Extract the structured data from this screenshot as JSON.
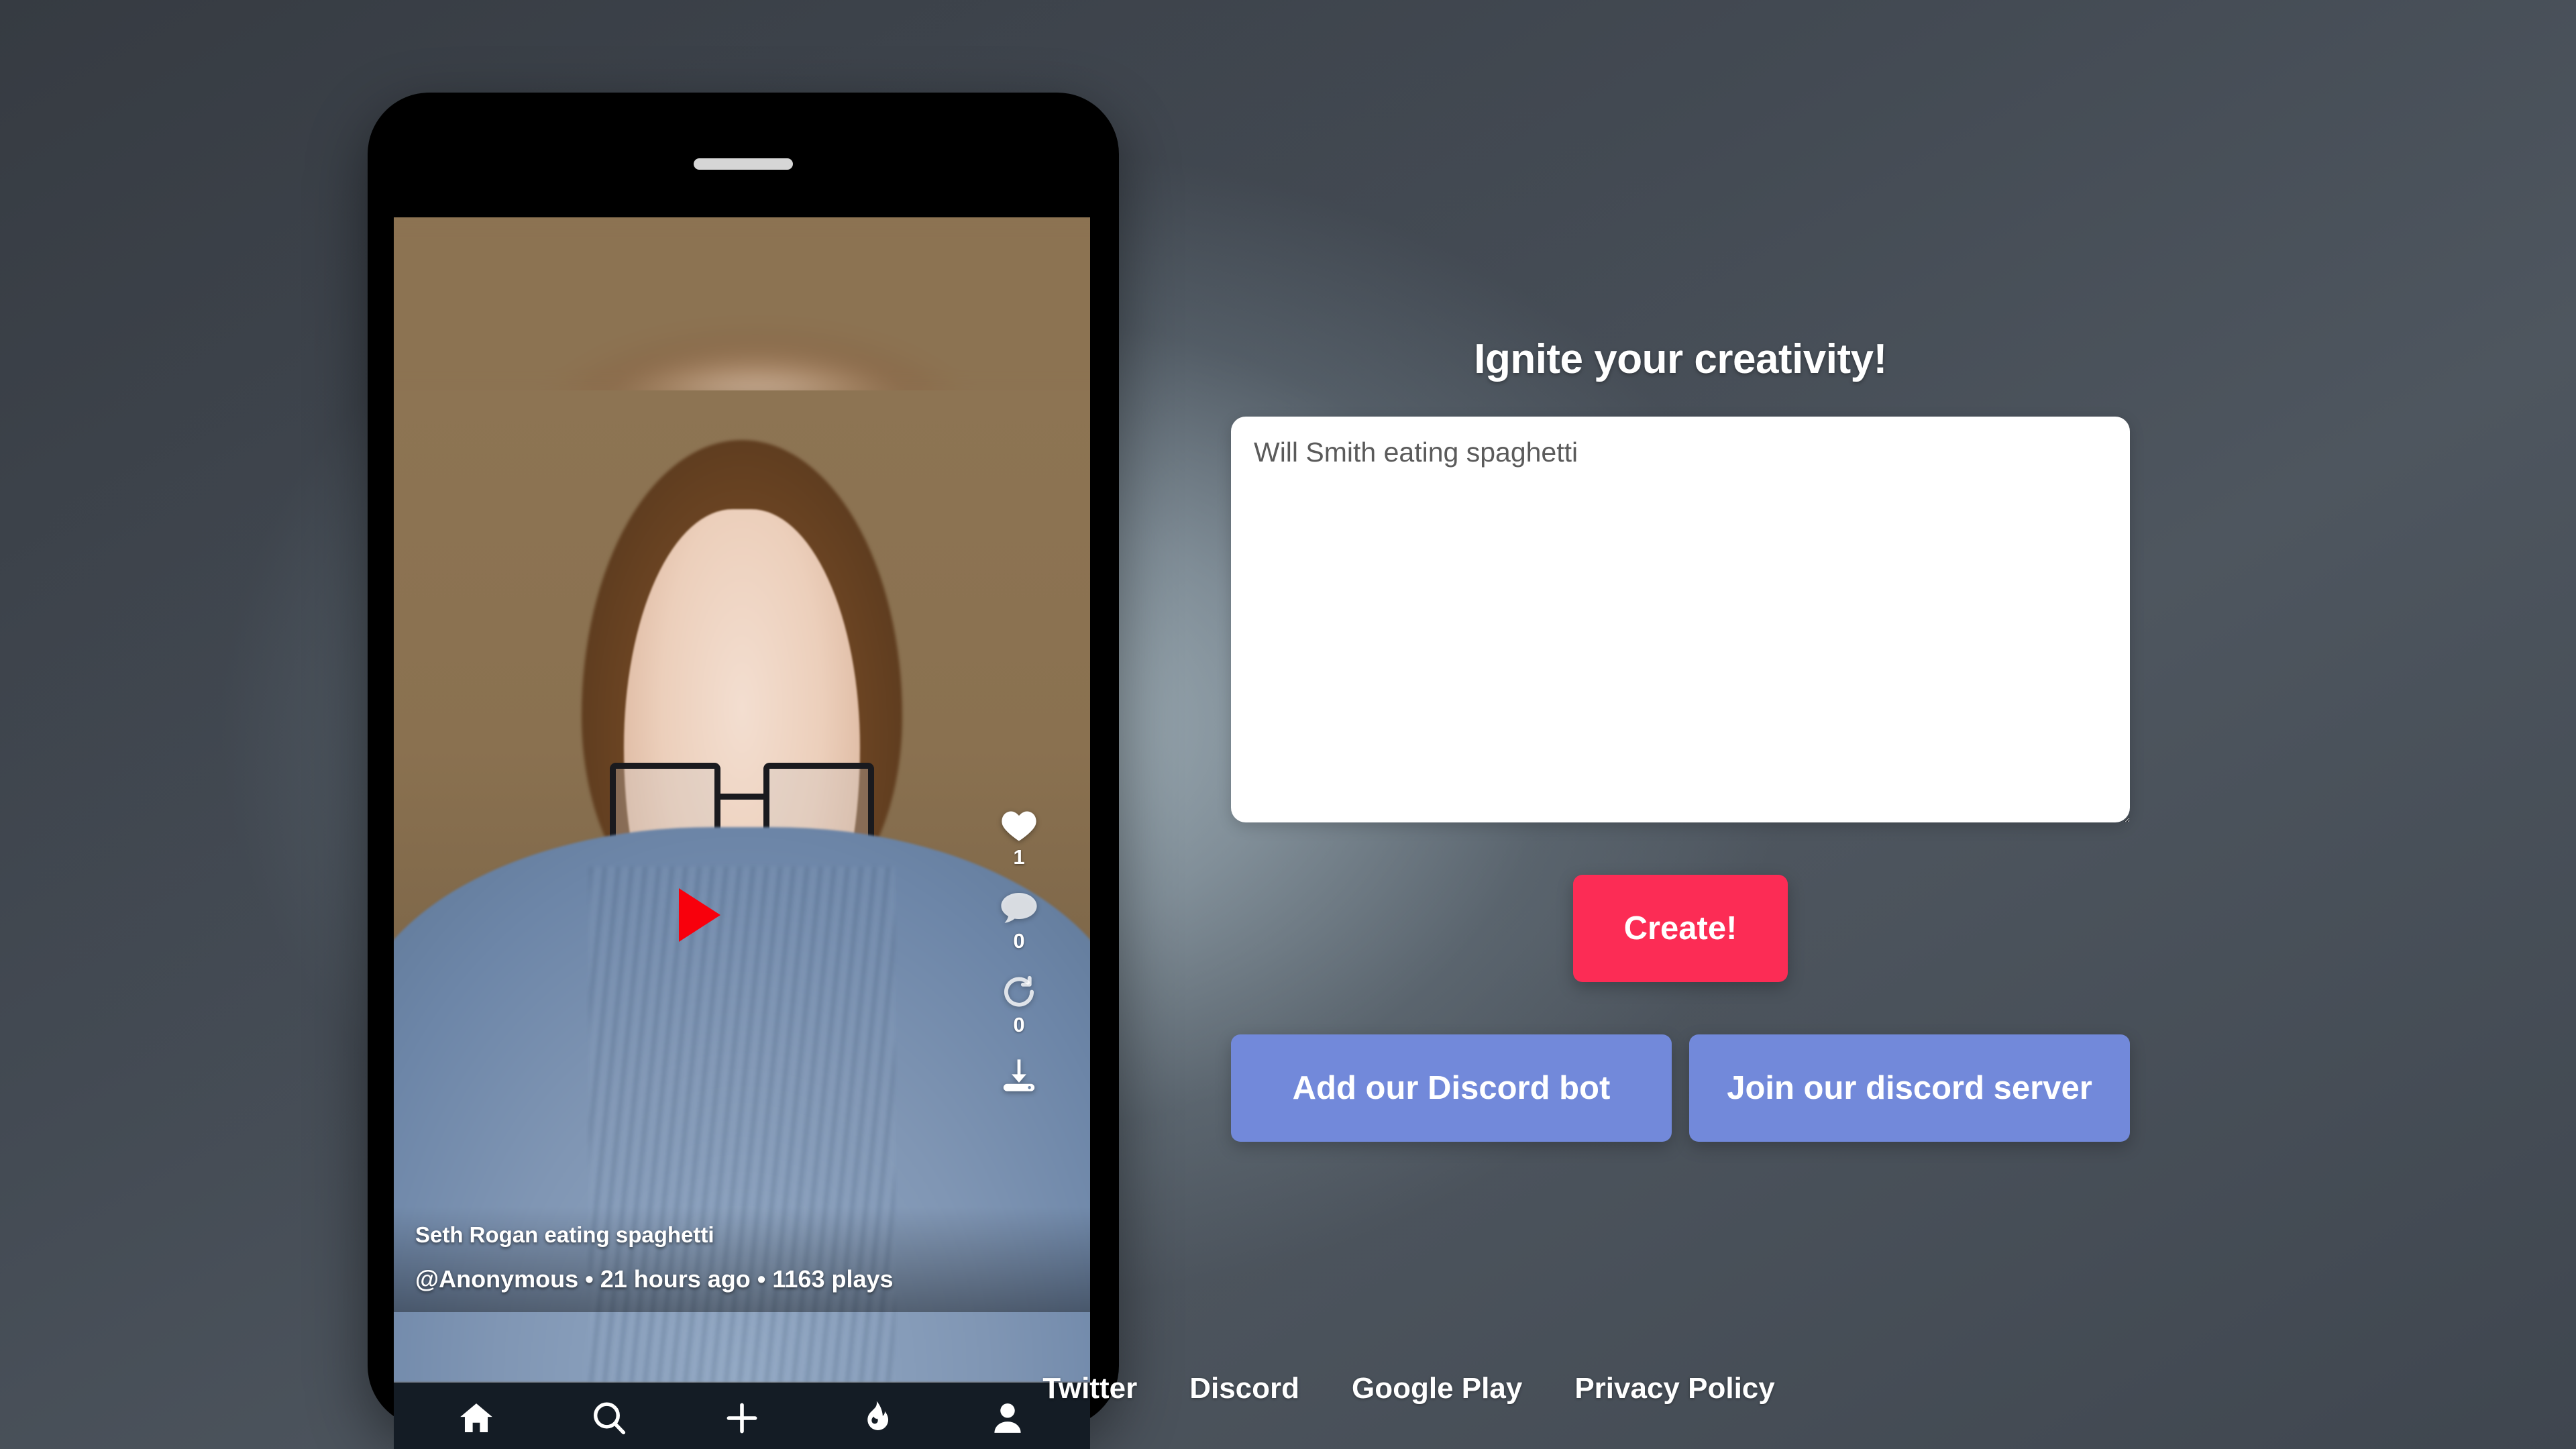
{
  "page": {
    "background_dark": "#4a515b",
    "background_light": "#a8b8c0"
  },
  "phone": {
    "video": {
      "title": "Seth Rogan eating spaghetti",
      "meta": "@Anonymous • 21 hours ago • 1163 plays",
      "play_icon": "play-icon",
      "actions": [
        {
          "icon": "heart-icon",
          "name": "like",
          "count": "1"
        },
        {
          "icon": "comment-icon",
          "name": "comment",
          "count": "0"
        },
        {
          "icon": "repost-icon",
          "name": "repost",
          "count": "0"
        },
        {
          "icon": "download-icon",
          "name": "download",
          "count": ""
        }
      ]
    },
    "nav": [
      {
        "icon": "home-icon",
        "label": "Home"
      },
      {
        "icon": "search-icon",
        "label": "Search"
      },
      {
        "icon": "plus-icon",
        "label": "Create"
      },
      {
        "icon": "fire-icon",
        "label": "Trending"
      },
      {
        "icon": "profile-icon",
        "label": "Profile"
      }
    ]
  },
  "creator": {
    "heading": "Ignite your creativity!",
    "prompt_value": "Will Smith eating spaghetti",
    "prompt_placeholder": "",
    "create_label": "Create!",
    "create_color": "#fc2c55",
    "discord_color": "#7289da",
    "discord_buttons": [
      {
        "label": "Add our Discord bot"
      },
      {
        "label": "Join our discord server"
      }
    ]
  },
  "footer": {
    "links": [
      {
        "label": "Twitter"
      },
      {
        "label": "Discord"
      },
      {
        "label": "Google Play"
      },
      {
        "label": "Privacy Policy"
      }
    ]
  }
}
